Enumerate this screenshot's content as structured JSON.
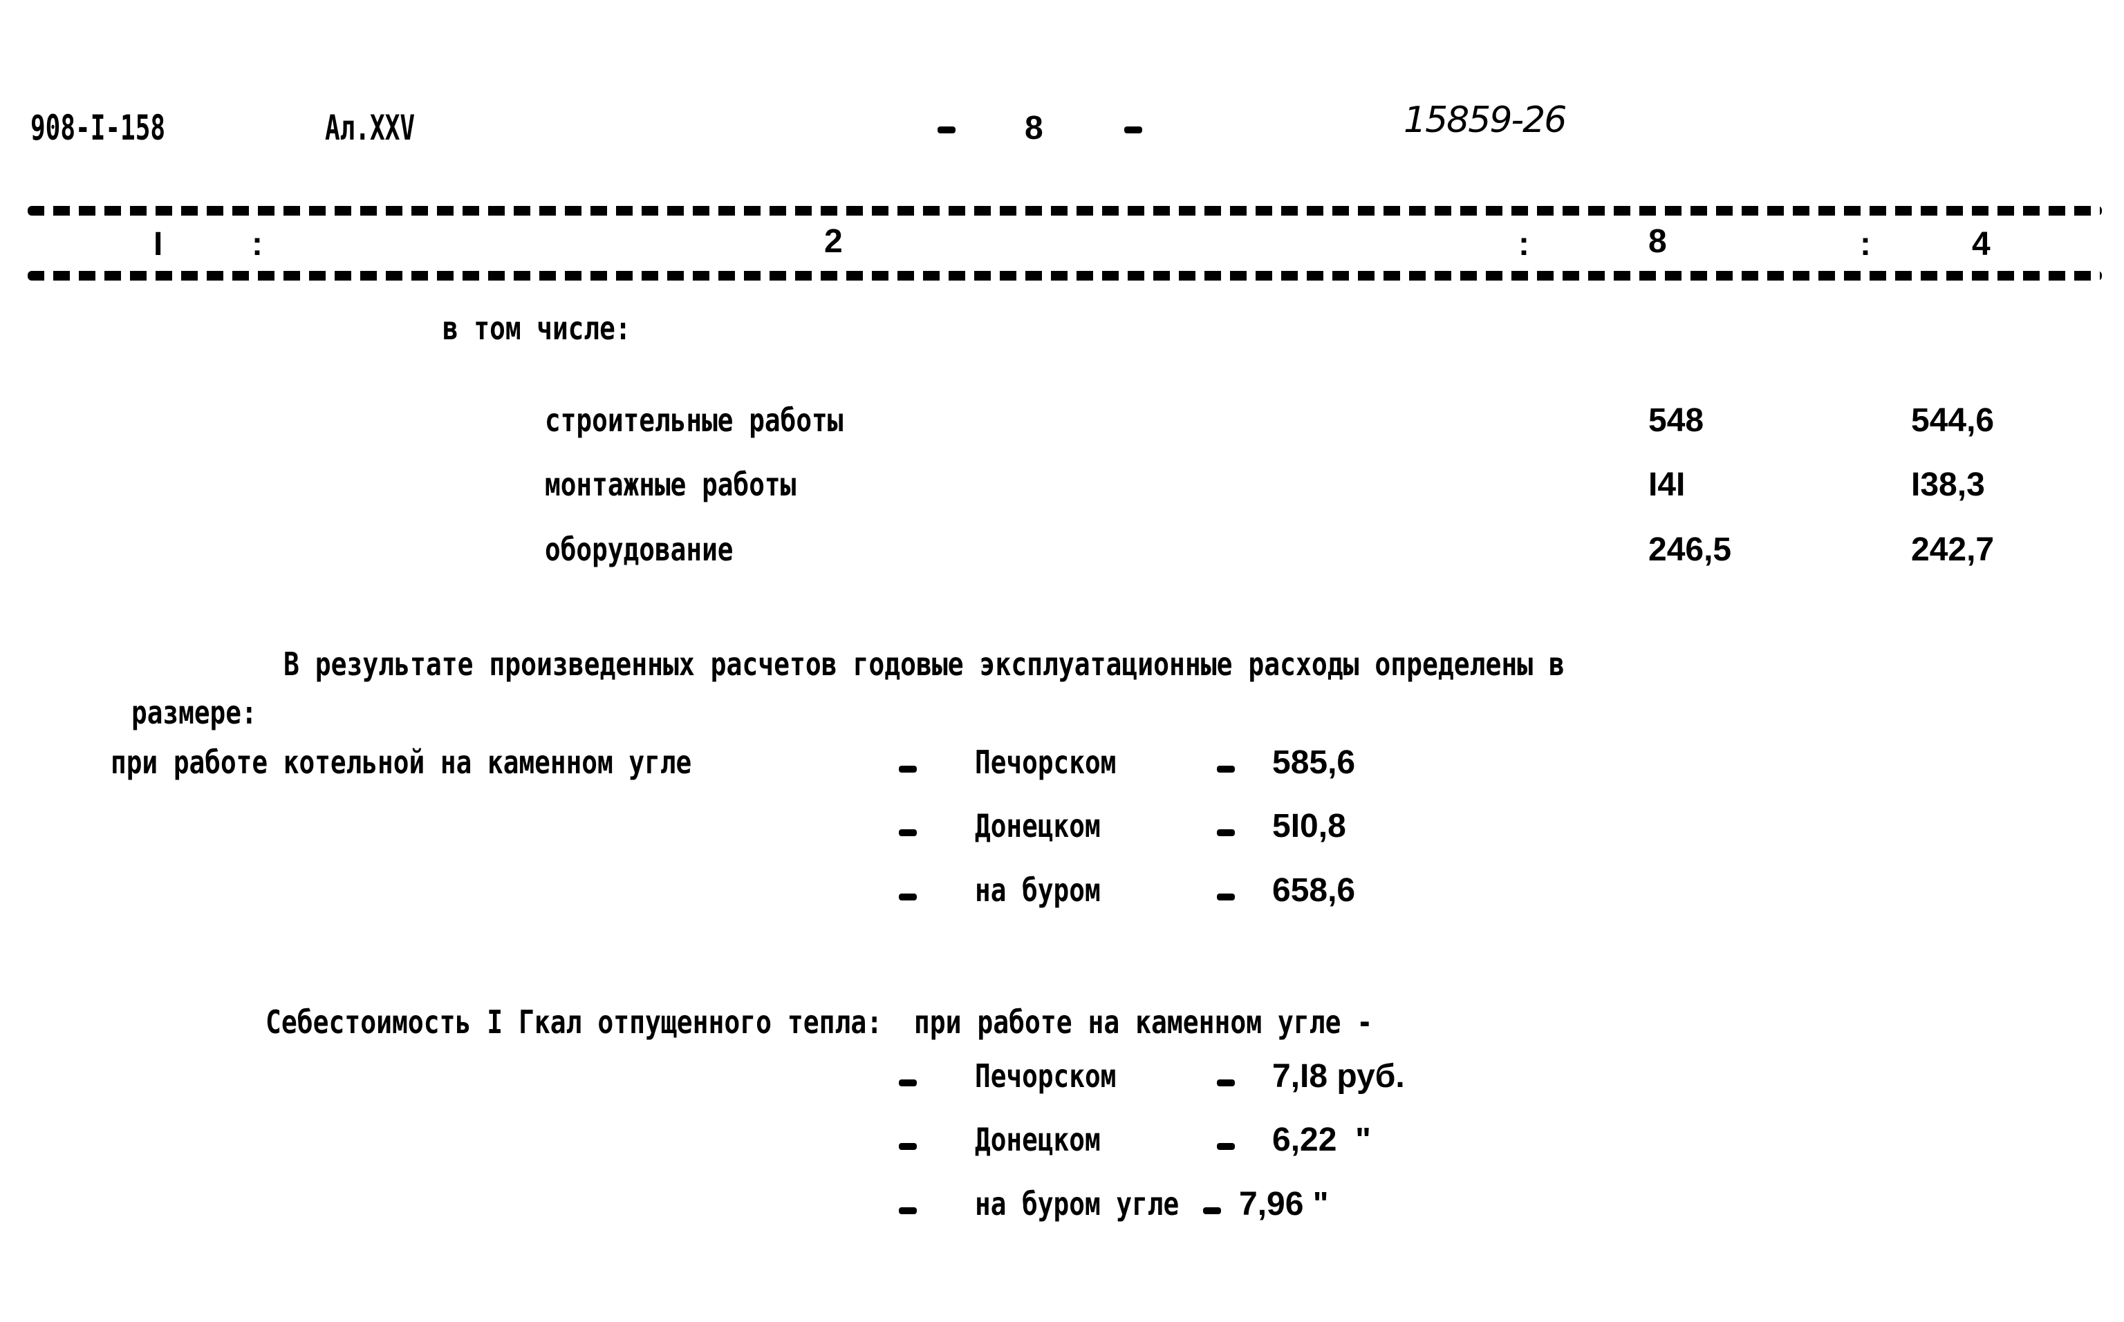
{
  "header": {
    "doc_code": "908-I-158",
    "album": "Ал.XXV",
    "page_dash_left": "-",
    "page_number": "8",
    "page_dash_right": "-",
    "handwritten_ref": "15859-26"
  },
  "table_header": {
    "columns": [
      "I",
      "2",
      "8",
      "4"
    ],
    "separator": ":"
  },
  "breakdown": {
    "intro": "в том числе:",
    "rows": [
      {
        "label": "строительные работы",
        "col3": "548",
        "col4": "544,6"
      },
      {
        "label": "монтажные работы",
        "col3": "I4I",
        "col4": "I38,3"
      },
      {
        "label": "оборудование",
        "col3": "246,5",
        "col4": "242,7"
      }
    ]
  },
  "annual_costs": {
    "paragraph_line1": "В результате произведенных расчетов годовые эксплуатационные расходы определены в",
    "paragraph_line2": "размере:",
    "lead": "при работе котельной на каменном угле",
    "items": [
      {
        "dash": "-",
        "fuel": "Печорском",
        "sep": "-",
        "value": "585,6"
      },
      {
        "dash": "-",
        "fuel": "Донецком",
        "sep": "-",
        "value": "5I0,8"
      },
      {
        "dash": "-",
        "fuel": "на буром",
        "sep": "-",
        "value": "658,6"
      }
    ]
  },
  "unit_cost": {
    "lead": "Себестоимость I Гкал отпущенного тепла:  при работе на каменном угле -",
    "items": [
      {
        "dash": "-",
        "fuel": "Печорском",
        "sep": "-",
        "value": "7,I8 руб."
      },
      {
        "dash": "-",
        "fuel": "Донецком",
        "sep": "-",
        "value": "6,22  \""
      },
      {
        "dash": "-",
        "fuel": "на буром угле",
        "sep": "-",
        "value": "7,96 \""
      }
    ]
  }
}
